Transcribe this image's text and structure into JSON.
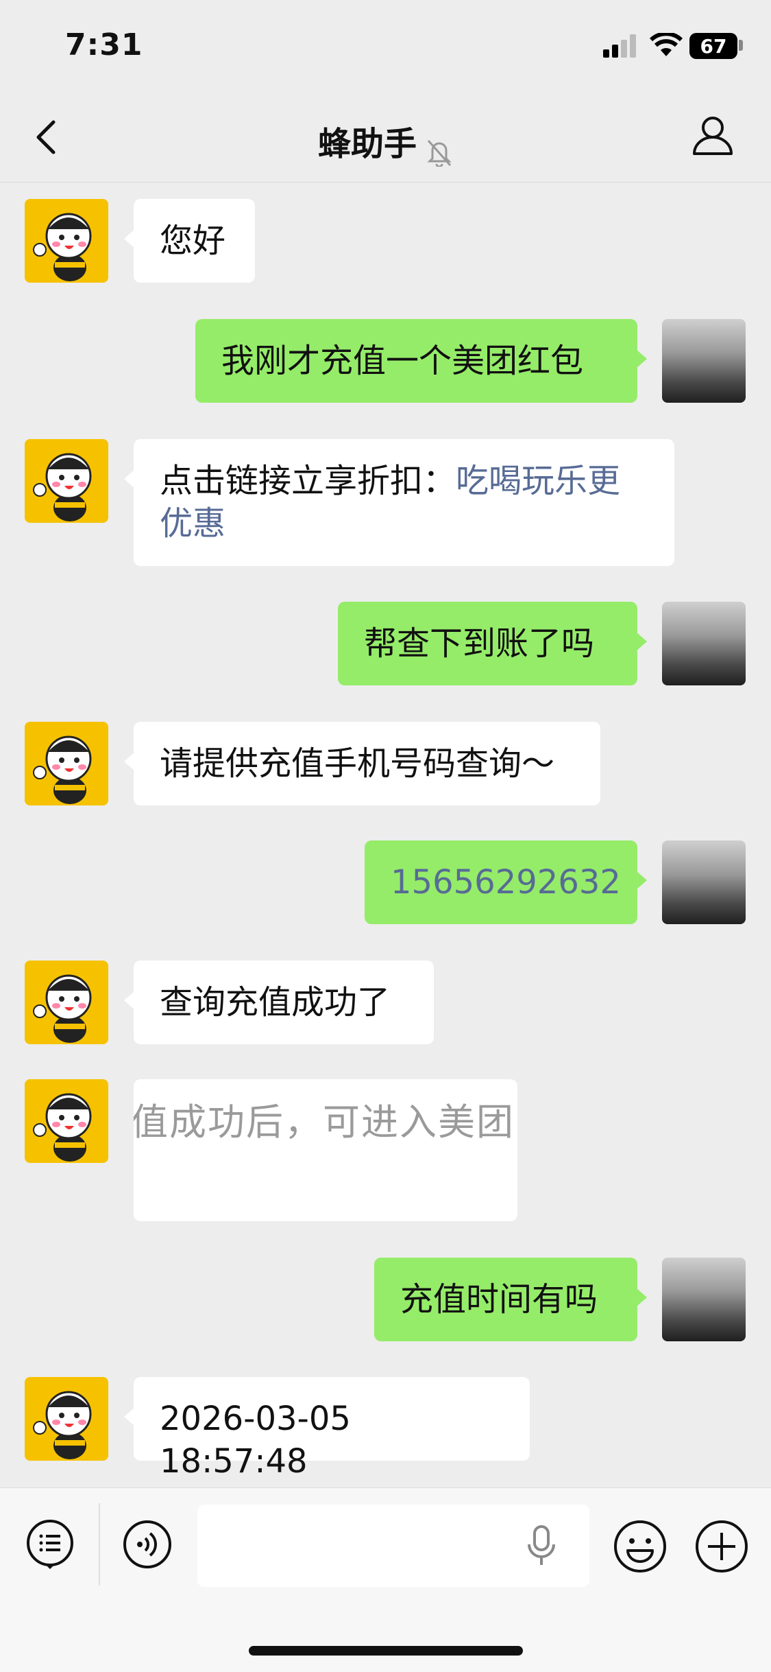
{
  "status_bar": {
    "time": "7:31",
    "battery": "67"
  },
  "header": {
    "title": "蜂助手",
    "back_icon": "chevron-left-icon",
    "mute_icon": "bell-off-icon",
    "profile_icon": "person-icon"
  },
  "messages": [
    {
      "side": "in",
      "text": "您好"
    },
    {
      "side": "out",
      "text": "我刚才充值一个美团红包"
    },
    {
      "side": "in",
      "text_prefix": "点击链接立享折扣：",
      "link_line1": "吃喝玩乐更",
      "link_line2": "优惠"
    },
    {
      "side": "out",
      "text": "帮查下到账了吗"
    },
    {
      "side": "in",
      "text": "请提供充值手机号码查询～"
    },
    {
      "side": "out",
      "text": "15656292632"
    },
    {
      "side": "in",
      "text": "查询充值成功了"
    },
    {
      "side": "in",
      "type": "image",
      "text": "值成功后，可进入美团"
    },
    {
      "side": "out",
      "text": "充值时间有吗"
    },
    {
      "side": "in",
      "text": "2026-03-05 18:57:48"
    }
  ],
  "input_bar": {
    "menu_icon": "list-menu-icon",
    "voice_icon": "voice-icon",
    "mic_icon": "microphone-icon",
    "emoji_icon": "emoji-icon",
    "plus_icon": "plus-icon"
  },
  "colors": {
    "background": "#ededed",
    "bubble_out": "#95ec69",
    "bubble_in": "#ffffff",
    "link": "#576b95"
  }
}
